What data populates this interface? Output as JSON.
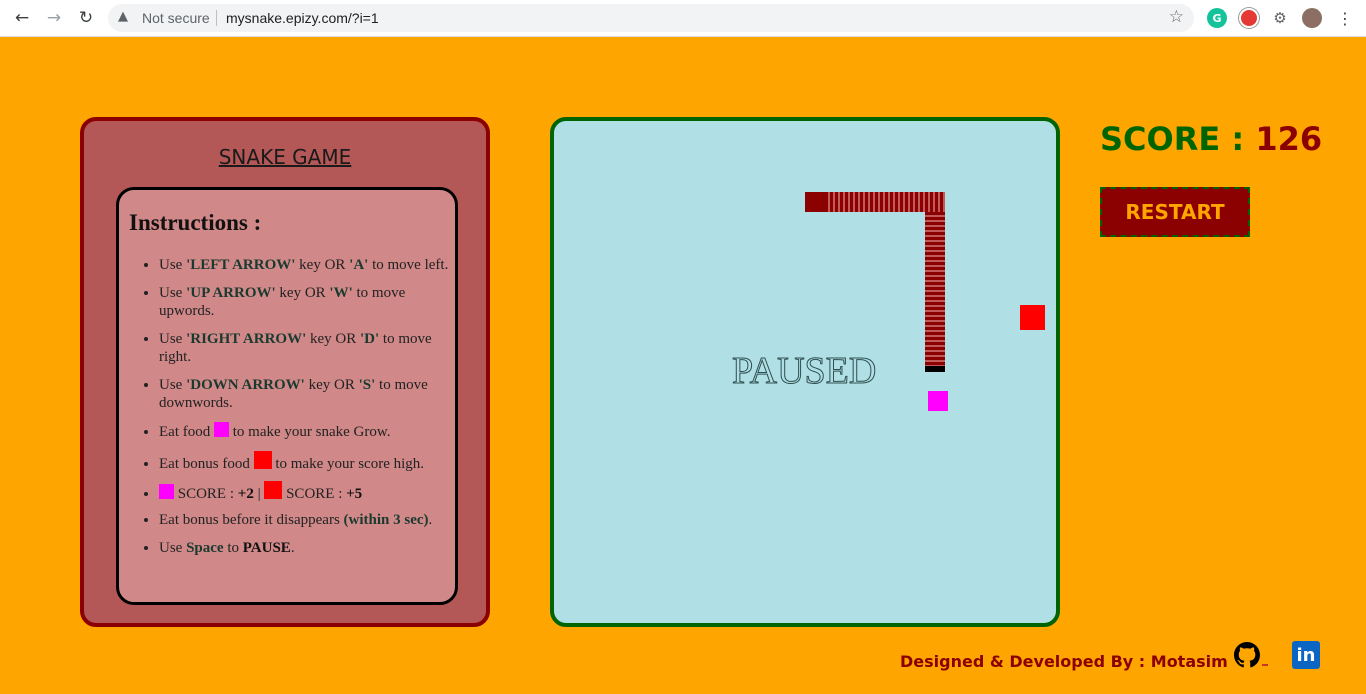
{
  "browser": {
    "security_label": "Not secure",
    "url": "mysnake.epizy.com/?i=1"
  },
  "panel": {
    "title": "SNAKE GAME",
    "heading": "Instructions :",
    "items": {
      "left": {
        "pre": "Use ",
        "key": "'LEFT ARROW'",
        "mid": " key OR ",
        "alt": "'A'",
        "post": " to move left."
      },
      "up": {
        "pre": "Use ",
        "key": "'UP ARROW'",
        "mid": " key OR ",
        "alt": "'W'",
        "post": " to move upwords."
      },
      "right": {
        "pre": "Use ",
        "key": "'RIGHT ARROW'",
        "mid": " key OR ",
        "alt": "'D'",
        "post": " to move right."
      },
      "down": {
        "pre": "Use ",
        "key": "'DOWN ARROW'",
        "mid": " key OR ",
        "alt": "'S'",
        "post": " to move downwords."
      },
      "food": {
        "pre": "Eat food ",
        "post": " to make your snake Grow."
      },
      "bonus": {
        "pre": "Eat bonus food ",
        "post": " to make your score high."
      },
      "scores": {
        "label1": " SCORE : ",
        "val1": "+2",
        "sep": " | ",
        "label2": " SCORE : ",
        "val2": "+5"
      },
      "timer": {
        "pre": "Eat bonus before it disappears ",
        "key": "(within 3 sec)",
        "post": "."
      },
      "pause": {
        "pre": "Use ",
        "key": "Space",
        "mid": " to ",
        "alt": "PAUSE",
        "post": "."
      }
    }
  },
  "game": {
    "status": "PAUSED",
    "food_color": "#FF00FF",
    "bonus_color": "#FF0000",
    "snake_color": "#8B0000"
  },
  "score": {
    "label": "SCORE : ",
    "value": "126"
  },
  "restart_label": "RESTART",
  "footer": {
    "credit": "Designed & Developed By : Motasim",
    "icons": [
      "github-icon",
      "linkedin-icon"
    ]
  }
}
